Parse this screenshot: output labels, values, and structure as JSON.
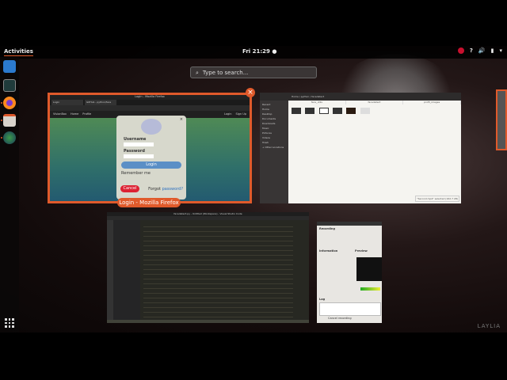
{
  "topbar": {
    "activities": "Activities",
    "clock": "Fri 21:29 ●"
  },
  "search": {
    "placeholder": "Type to search..."
  },
  "dock": {
    "apps": [
      "Visual Studio Code",
      "System Monitor",
      "Firefox",
      "Files",
      "Screenshot"
    ]
  },
  "firefox": {
    "label": "Login - Mozilla Firefox",
    "tabs": [
      "Login",
      "GitHub - python/face"
    ],
    "nav": [
      "VisionBox",
      "Home",
      "Profile"
    ],
    "nav_right": [
      "Login",
      "Sign Up"
    ],
    "modal": {
      "username": "Username",
      "password": "Password",
      "login": "Login",
      "remember": "Remember me",
      "cancel": "Cancel",
      "forgot_prefix": "Forgot ",
      "forgot_link": "password?"
    }
  },
  "files": {
    "breadcrumb": "Home  /  python  /  facedetect",
    "sidebar": [
      "Recent",
      "Home",
      "Desktop",
      "Documents",
      "Downloads",
      "Music",
      "Pictures",
      "Videos",
      "Trash",
      "+ Other Locations"
    ],
    "columns": [
      "face_utils",
      "facedetect",
      "profil_images"
    ],
    "status": "\"Second.mp4\" selected (162.7 kB)"
  },
  "vscode": {
    "title": "facedetect.py - Untitled (Workspace) - Visual Studio Code"
  },
  "obs": {
    "recording": "Recording",
    "information": "Information",
    "preview": "Preview",
    "log": "Log",
    "cancel": "Cancel recording"
  },
  "watermark": "LAYLIA",
  "colors": {
    "accent": "#e05a2b"
  }
}
